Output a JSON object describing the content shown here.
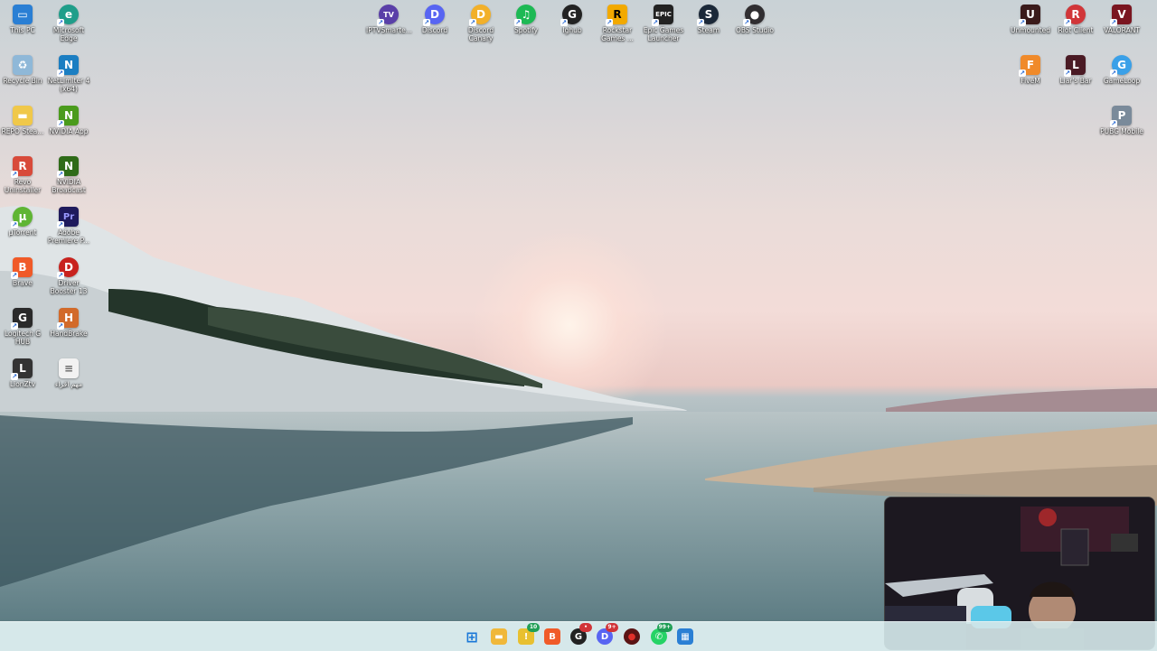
{
  "desktop_icons_left": [
    {
      "id": "this-pc",
      "label": "This PC",
      "glyph": "▭",
      "color": "#2a7fd4"
    },
    {
      "id": "microsoft-edge",
      "label": "Microsoft\nEdge",
      "glyph": "e",
      "color": "#1f9e8a"
    },
    {
      "id": "recycle-bin",
      "label": "Recycle Bin",
      "glyph": "♻",
      "color": "#8fb8d8"
    },
    {
      "id": "netlimiter",
      "label": "NetLimiter 4\n(x64)",
      "glyph": "N",
      "color": "#1b7ec2"
    },
    {
      "id": "repo-steam",
      "label": "REPO Stea...",
      "glyph": "▬",
      "color": "#f0c84a"
    },
    {
      "id": "nvidia-app",
      "label": "NVIDIA App",
      "glyph": "N",
      "color": "#4a9b1c"
    },
    {
      "id": "revo-uninstaller",
      "label": "Revo\nUninstaller",
      "glyph": "R",
      "color": "#d84a3a"
    },
    {
      "id": "nvidia-broadcast",
      "label": "NVIDIA\nBroadcast",
      "glyph": "N",
      "color": "#2f6b18"
    },
    {
      "id": "utorrent",
      "label": "µTorrent",
      "glyph": "µ",
      "color": "#5fb533"
    },
    {
      "id": "adobe-premiere",
      "label": "Adobe\nPremiere P...",
      "glyph": "Pr",
      "color": "#1e1a5c"
    },
    {
      "id": "brave",
      "label": "Brave",
      "glyph": "B",
      "color": "#f05a28"
    },
    {
      "id": "driver-booster",
      "label": "Driver\nBooster 13",
      "glyph": "D",
      "color": "#c8221e"
    },
    {
      "id": "logitech-ghub",
      "label": "Logitech G\nHUB",
      "glyph": "G",
      "color": "#2a2a2a"
    },
    {
      "id": "handbrake",
      "label": "HandBrake",
      "glyph": "H",
      "color": "#d26a2a"
    },
    {
      "id": "liontv",
      "label": "LionZtv",
      "glyph": "L",
      "color": "#333333"
    },
    {
      "id": "arabic-file",
      "label": "مهم اقراء",
      "glyph": "≡",
      "color": "#e8e8e8"
    }
  ],
  "desktop_icons_top": [
    {
      "id": "iptv",
      "label": "IPTVSmarte...",
      "glyph": "TV",
      "color": "#5a3fa8"
    },
    {
      "id": "discord",
      "label": "Discord",
      "glyph": "D",
      "color": "#5865f2"
    },
    {
      "id": "discord-canary",
      "label": "Discord\nCanary",
      "glyph": "D",
      "color": "#f2b02a"
    },
    {
      "id": "spotify",
      "label": "Spotify",
      "glyph": "♫",
      "color": "#1db954"
    },
    {
      "id": "ighub",
      "label": "Ighub",
      "glyph": "G",
      "color": "#222222"
    },
    {
      "id": "rockstar",
      "label": "Rockstar\nGames ...",
      "glyph": "R",
      "color": "#f2a900"
    },
    {
      "id": "epic-games",
      "label": "Epic Games\nLauncher",
      "glyph": "E",
      "color": "#222222"
    },
    {
      "id": "steam",
      "label": "Steam",
      "glyph": "S",
      "color": "#1b2838"
    },
    {
      "id": "obs",
      "label": "OBS Studio",
      "glyph": "●",
      "color": "#302e31"
    }
  ],
  "desktop_icons_right": [
    {
      "id": "unmounted",
      "label": "Unmounted",
      "glyph": "U",
      "color": "#3a1a1a"
    },
    {
      "id": "riot-client",
      "label": "Riot Client",
      "glyph": "R",
      "color": "#d13639"
    },
    {
      "id": "valorant",
      "label": "VALORANT",
      "glyph": "V",
      "color": "#7a1520"
    },
    {
      "id": "fivem",
      "label": "FiveM",
      "glyph": "F",
      "color": "#f08a2a"
    },
    {
      "id": "liars-bar",
      "label": "Liar's Bar",
      "glyph": "L",
      "color": "#4a1a24"
    },
    {
      "id": "gameloop",
      "label": "GameLoop",
      "glyph": "G",
      "color": "#3aa0e8"
    },
    {
      "id": "pubg-mobile",
      "label": "PUBG Mobile",
      "glyph": "P",
      "color": "#7a8a9a"
    }
  ],
  "taskbar": {
    "items": [
      {
        "id": "start",
        "glyph": "⊞",
        "color": "#1a78d8",
        "badge": ""
      },
      {
        "id": "file-explorer",
        "glyph": "▬",
        "color": "#f0b83a",
        "badge": ""
      },
      {
        "id": "notification-app",
        "glyph": "🔔",
        "color": "#e8c030",
        "badge": "10"
      },
      {
        "id": "brave",
        "glyph": "B",
        "color": "#f05a28",
        "badge": ""
      },
      {
        "id": "ighub",
        "glyph": "G",
        "color": "#222222",
        "badge": "•"
      },
      {
        "id": "discord",
        "glyph": "D",
        "color": "#5865f2",
        "badge": "9+"
      },
      {
        "id": "record",
        "glyph": "●",
        "color": "#5a1414",
        "badge": ""
      },
      {
        "id": "whatsapp",
        "glyph": "✆",
        "color": "#25d366",
        "badge": "99+"
      },
      {
        "id": "photos",
        "glyph": "▦",
        "color": "#2a7fd4",
        "badge": ""
      }
    ]
  },
  "colors": {
    "badge_red": "#d13438",
    "badge_green": "#1f9e55"
  }
}
